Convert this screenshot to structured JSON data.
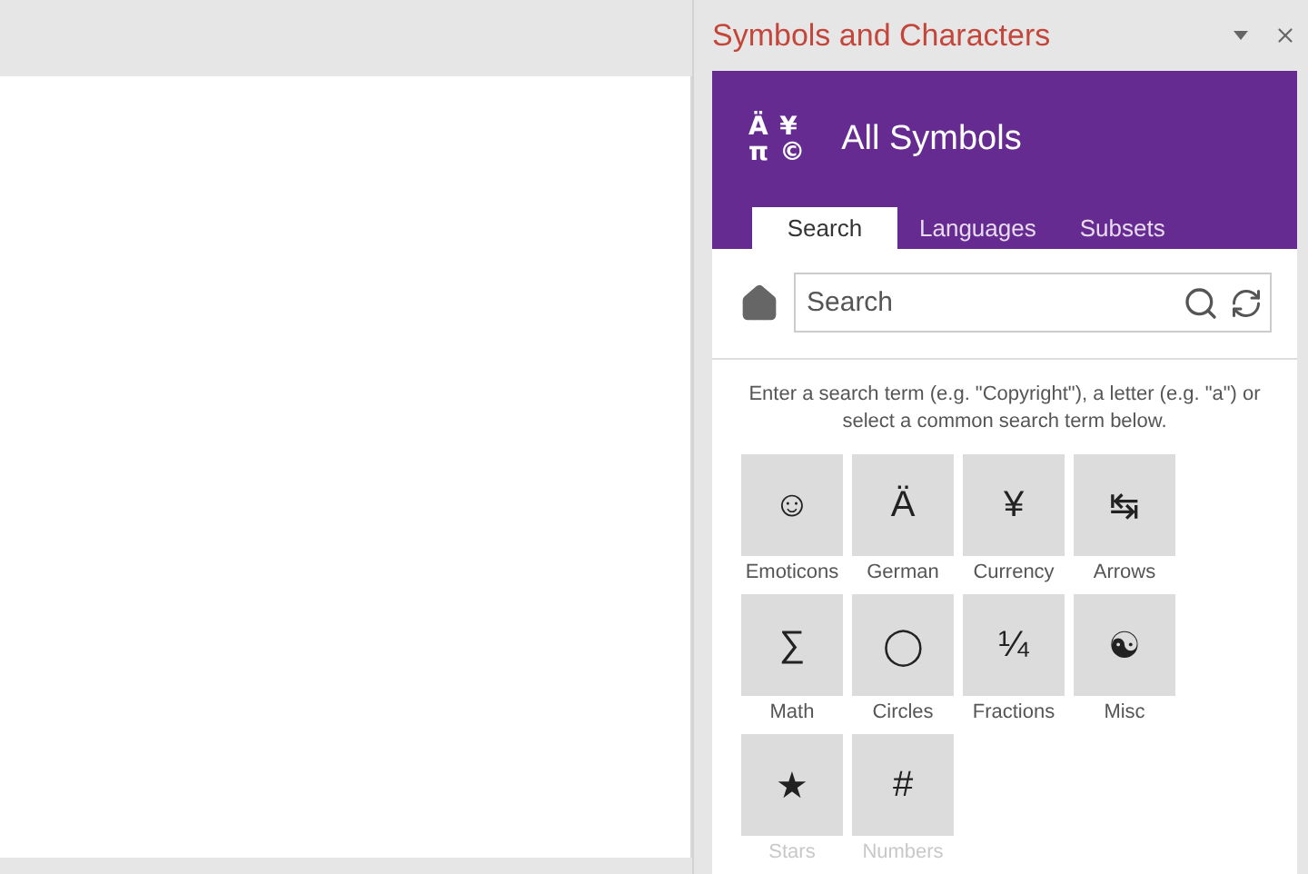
{
  "pane": {
    "title": "Symbols and Characters"
  },
  "header": {
    "icon_glyphs": [
      "Ä",
      "¥",
      "π",
      "©"
    ],
    "title": "All Symbols"
  },
  "tabs": [
    {
      "label": "Search",
      "selected": true
    },
    {
      "label": "Languages",
      "selected": false
    },
    {
      "label": "Subsets",
      "selected": false
    }
  ],
  "search": {
    "placeholder": "Search"
  },
  "hint": "Enter a search term (e.g. \"Copyright\"), a letter (e.g. \"a\") or select a common search term below.",
  "tiles": [
    {
      "glyph": "☺",
      "label": "Emoticons",
      "faded": false
    },
    {
      "glyph": "Ä",
      "label": "German",
      "faded": false
    },
    {
      "glyph": "¥",
      "label": "Currency",
      "faded": false
    },
    {
      "glyph": "↹",
      "label": "Arrows",
      "faded": false
    },
    {
      "glyph": "∑",
      "label": "Math",
      "faded": false
    },
    {
      "glyph": "◯",
      "label": "Circles",
      "faded": false
    },
    {
      "glyph": "¼",
      "label": "Fractions",
      "faded": false
    },
    {
      "glyph": "☯",
      "label": "Misc",
      "faded": false
    },
    {
      "glyph": "★",
      "label": "Stars",
      "faded": true
    },
    {
      "glyph": "#",
      "label": "Numbers",
      "faded": true
    }
  ]
}
